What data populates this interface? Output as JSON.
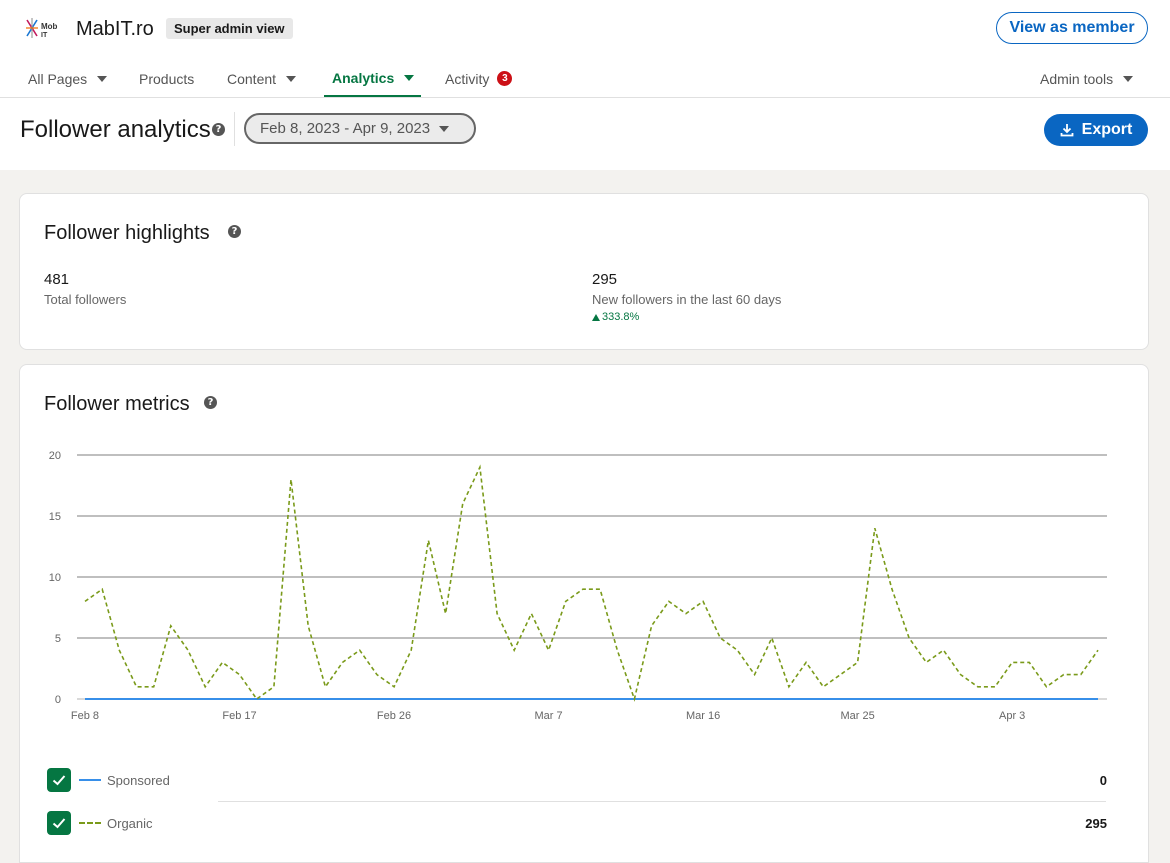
{
  "header": {
    "brand_name": "MabIT.ro",
    "admin_badge": "Super admin view",
    "view_as_member": "View as member"
  },
  "nav": {
    "all_pages": "All Pages",
    "products": "Products",
    "content": "Content",
    "analytics": "Analytics",
    "activity": "Activity",
    "activity_count": "3",
    "admin_tools": "Admin tools"
  },
  "page": {
    "title": "Follower analytics",
    "date_range": "Feb 8, 2023 - Apr 9, 2023",
    "export_label": "Export"
  },
  "highlights": {
    "title": "Follower highlights",
    "total_value": "481",
    "total_label": "Total followers",
    "new_value": "295",
    "new_label": "New followers in the last 60 days",
    "new_change": "333.8%"
  },
  "metrics": {
    "title": "Follower metrics",
    "sponsored_label": "Sponsored",
    "sponsored_total": "0",
    "organic_label": "Organic",
    "organic_total": "295"
  },
  "colors": {
    "accent": "#0a66c2",
    "positive": "#057642",
    "sponsored_line": "#378fe9",
    "organic_line": "#7a9a1a"
  },
  "chart_data": {
    "type": "line",
    "ylim": [
      0,
      20
    ],
    "y_ticks": [
      0,
      5,
      10,
      15,
      20
    ],
    "x_tick_labels": [
      "Feb 8",
      "Feb 17",
      "Feb 26",
      "Mar 7",
      "Mar 16",
      "Mar 25",
      "Apr 3"
    ],
    "x_tick_indices": [
      0,
      9,
      18,
      27,
      36,
      45,
      54
    ],
    "grid": true,
    "series": [
      {
        "name": "Sponsored",
        "style": "solid",
        "values": [
          0,
          0,
          0,
          0,
          0,
          0,
          0,
          0,
          0,
          0,
          0,
          0,
          0,
          0,
          0,
          0,
          0,
          0,
          0,
          0,
          0,
          0,
          0,
          0,
          0,
          0,
          0,
          0,
          0,
          0,
          0,
          0,
          0,
          0,
          0,
          0,
          0,
          0,
          0,
          0,
          0,
          0,
          0,
          0,
          0,
          0,
          0,
          0,
          0,
          0,
          0,
          0,
          0,
          0,
          0,
          0,
          0,
          0,
          0,
          0,
          0
        ]
      },
      {
        "name": "Organic",
        "style": "dashed",
        "values": [
          8,
          9,
          4,
          1,
          1,
          6,
          4,
          1,
          3,
          2,
          0,
          1,
          18,
          6,
          1,
          3,
          4,
          2,
          1,
          4,
          13,
          7,
          16,
          19,
          7,
          4,
          7,
          4,
          8,
          9,
          9,
          4,
          0,
          6,
          8,
          7,
          8,
          5,
          4,
          2,
          5,
          1,
          3,
          1,
          2,
          3,
          14,
          9,
          5,
          3,
          4,
          2,
          1,
          1,
          3,
          3,
          1,
          2,
          2,
          4
        ]
      }
    ]
  }
}
